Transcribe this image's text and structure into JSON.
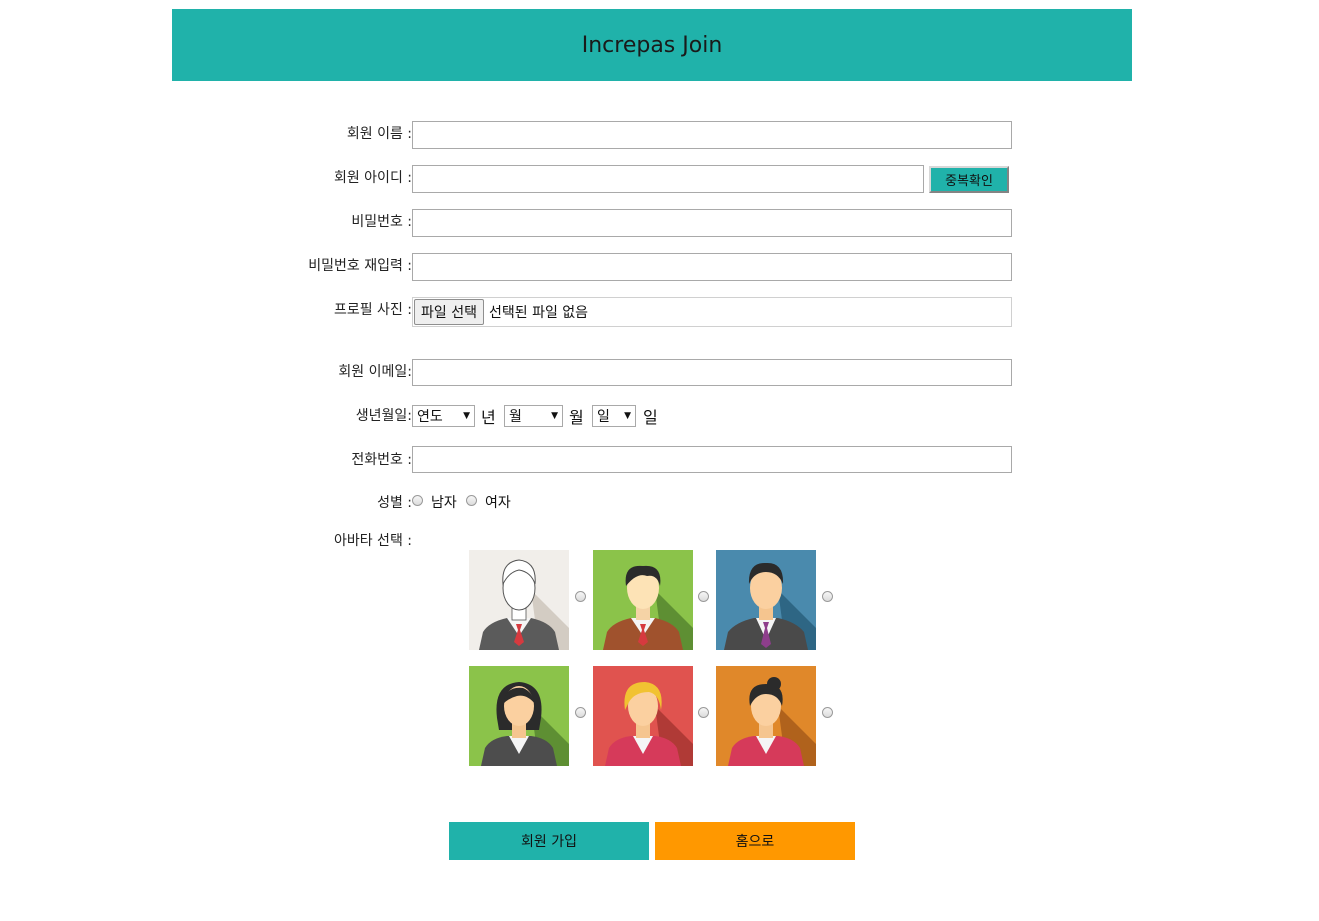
{
  "header": {
    "title": "Increpas Join"
  },
  "form": {
    "name_label": "회원 이름 :",
    "id_label": "회원 아이디 :",
    "dup_check_label": "중복확인",
    "password_label": "비밀번호 :",
    "password_confirm_label": "비밀번호 재입력 :",
    "profile_label": "프로필 사진 :",
    "file_button_label": "파일 선택",
    "file_status": "선택된 파일 없음",
    "email_label": "회원 이메일:",
    "birth_label": "생년월일:",
    "birth_year_selected": "연도",
    "birth_year_unit": "년",
    "birth_month_selected": "월",
    "birth_month_unit": "월",
    "birth_day_selected": "일",
    "birth_day_unit": "일",
    "phone_label": "전화번호 :",
    "gender_label": "성별 :",
    "gender_male": "남자",
    "gender_female": "여자",
    "avatar_label": "아바타 선택 :",
    "avatars": [
      {
        "name": "avatar-man-white",
        "bg": "#f1eeea",
        "shadow": "#d3ccc3"
      },
      {
        "name": "avatar-man-green",
        "bg": "#8bc34a",
        "shadow": "#5e8f33"
      },
      {
        "name": "avatar-man-blue",
        "bg": "#4a8aad",
        "shadow": "#2e6684"
      },
      {
        "name": "avatar-woman-green",
        "bg": "#8bc34a",
        "shadow": "#5e8f33"
      },
      {
        "name": "avatar-woman-red",
        "bg": "#e0534f",
        "shadow": "#b03a36"
      },
      {
        "name": "avatar-woman-orange",
        "bg": "#e0882a",
        "shadow": "#b0621c"
      }
    ]
  },
  "actions": {
    "join_label": "회원 가입",
    "home_label": "홈으로"
  },
  "colors": {
    "accent": "#20b2aa",
    "home": "#ff9800"
  }
}
